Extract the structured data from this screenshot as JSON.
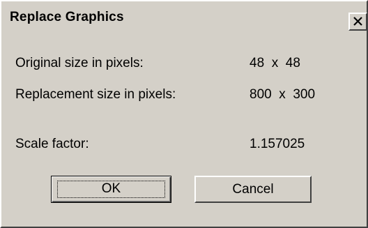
{
  "dialog": {
    "title": "Replace Graphics",
    "close_label": "Close"
  },
  "rows": {
    "original_label": "Original size in pixels:",
    "original_value": "48  x  48",
    "replacement_label": "Replacement size in pixels:",
    "replacement_value": "800  x  300",
    "scale_label": "Scale factor:",
    "scale_value": "1.157025"
  },
  "buttons": {
    "ok_label": "OK",
    "cancel_label": "Cancel"
  },
  "icons": {
    "close": "close-icon"
  }
}
